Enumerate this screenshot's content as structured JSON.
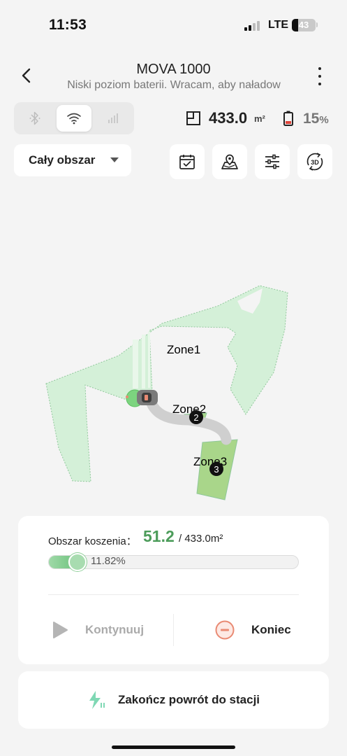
{
  "status_bar": {
    "time": "11:53",
    "network": "LTE",
    "battery_level": "43"
  },
  "header": {
    "title": "MOVA 1000",
    "subtitle": "Niski poziom baterii. Wracam, aby naładow"
  },
  "connectivity": {
    "options": [
      "bluetooth",
      "wifi",
      "cellular"
    ],
    "selected": "wifi"
  },
  "stats": {
    "area_value": "433.0",
    "area_unit": "m²",
    "battery_value": "15",
    "battery_unit": "%"
  },
  "zone_selector": {
    "selected": "Cały obszar"
  },
  "tools": [
    "calendar-icon",
    "map-edit-icon",
    "settings-sliders-icon",
    "3d-view-icon"
  ],
  "tool_3d_label": "3D",
  "map": {
    "zones": [
      {
        "label": "Zone1"
      },
      {
        "label": "Zone2",
        "order": "2"
      },
      {
        "label": "Zone3",
        "order": "3"
      }
    ]
  },
  "progress": {
    "label": "Obszar koszenia：",
    "mowed_value": "51.2",
    "total_text": "/ 433.0m²",
    "percent_text": "11.82%",
    "fraction": 0.1182
  },
  "actions": {
    "continue_label": "Kontynuuj",
    "end_label": "Koniec",
    "return_label": "Zakończ powrót do stacji"
  },
  "colors": {
    "accent_green": "#4c9c5a",
    "zone_fill": "#d4f0d8",
    "zone3_fill": "#a9d68a",
    "end_orange": "#e98a73",
    "return_icon": "#7fd8b4"
  }
}
